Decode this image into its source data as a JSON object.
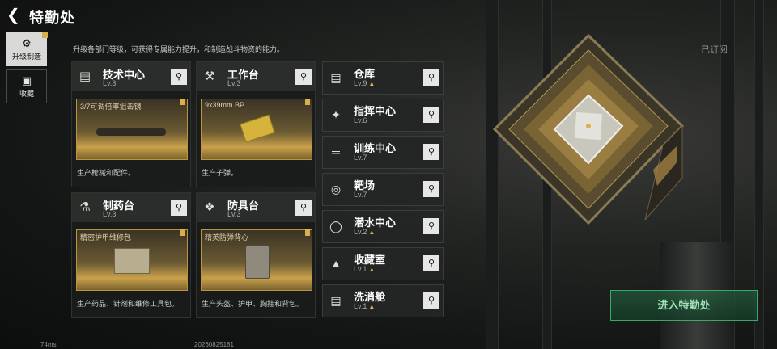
{
  "header": {
    "title": "特勤处",
    "subscribed": "已订阅"
  },
  "sidebar": {
    "items": [
      {
        "label": "升级制造",
        "icon": "upgrade-icon",
        "active": true
      },
      {
        "label": "收藏",
        "icon": "collection-icon",
        "active": false
      }
    ]
  },
  "description": "升级各部门等级，可获得专属能力提升，和制造战斗物资的能力。",
  "cards": [
    {
      "name": "技术中心",
      "level": "Lv.3",
      "icon": "monitor-icon",
      "item": "3/7可调倍率狙击镜",
      "footer": "生产枪械和配件。"
    },
    {
      "name": "工作台",
      "level": "Lv.3",
      "icon": "tools-icon",
      "item": "9x39mm BP",
      "footer": "生产子弹。"
    },
    {
      "name": "制药台",
      "level": "Lv.3",
      "icon": "microscope-icon",
      "item": "精密护甲维修包",
      "footer": "生产药品、针剂和维修工具包。"
    },
    {
      "name": "防具台",
      "level": "Lv.3",
      "icon": "armor-icon",
      "item": "精英防弹背心",
      "footer": "生产头盔、护甲、胸挂和背包。"
    }
  ],
  "departments": [
    {
      "name": "仓库",
      "level": "Lv.9",
      "upgrade": true,
      "icon": "warehouse-icon"
    },
    {
      "name": "指挥中心",
      "level": "Lv.6",
      "upgrade": false,
      "icon": "chip-icon"
    },
    {
      "name": "训练中心",
      "level": "Lv.7",
      "upgrade": false,
      "icon": "dumbbell-icon"
    },
    {
      "name": "靶场",
      "level": "Lv.7",
      "upgrade": false,
      "icon": "target-icon"
    },
    {
      "name": "潜水中心",
      "level": "Lv.2",
      "upgrade": true,
      "icon": "diving-icon"
    },
    {
      "name": "收藏室",
      "level": "Lv.1",
      "upgrade": true,
      "icon": "trophy-icon"
    },
    {
      "name": "洗消舱",
      "level": "Lv.1",
      "upgrade": true,
      "icon": "shower-icon"
    }
  ],
  "enter_button": "进入特勤处",
  "status": {
    "ping": "74ms",
    "build": "20260825181"
  },
  "colors": {
    "accent": "#d9b04a",
    "enter": "#3aa86b"
  }
}
